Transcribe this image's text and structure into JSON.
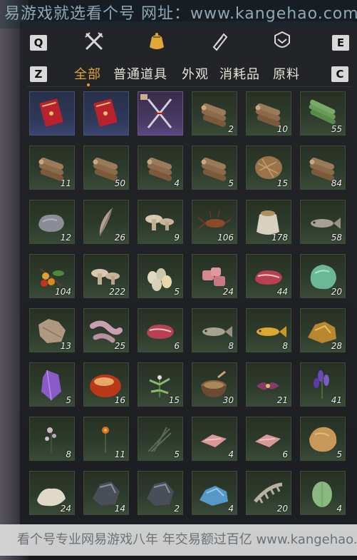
{
  "banner": {
    "text": "易游戏就选看个号   网址：www.kangehao.com"
  },
  "tabs": {
    "left_key": "Q",
    "right_key": "E",
    "icons": [
      "crossed-swords-icon",
      "pouch-icon",
      "scroll-icon",
      "shield-badge-icon"
    ],
    "active_icon": "pouch-icon"
  },
  "categories": {
    "left_key": "Z",
    "right_key": "C",
    "items": [
      "全部",
      "普通道具",
      "外观",
      "消耗品",
      "原料"
    ],
    "active": "全部"
  },
  "inventory": {
    "rows": [
      [
        {
          "icon": "red-envelope-icon",
          "qty": "",
          "rarity": "blue"
        },
        {
          "icon": "red-envelope-icon",
          "qty": "",
          "rarity": "blue"
        },
        {
          "icon": "crossed-blades-icon",
          "qty": "",
          "rarity": "purple"
        },
        {
          "icon": "wood-logs-icon",
          "qty": "2",
          "rarity": "green"
        },
        {
          "icon": "wood-logs-icon",
          "qty": "10",
          "rarity": "green"
        },
        {
          "icon": "bamboo-logs-icon",
          "qty": "55",
          "rarity": "green"
        }
      ],
      [
        {
          "icon": "wood-logs-icon",
          "qty": "11",
          "rarity": "green"
        },
        {
          "icon": "wood-logs-icon",
          "qty": "50",
          "rarity": "green"
        },
        {
          "icon": "wood-logs-icon",
          "qty": "4",
          "rarity": "green"
        },
        {
          "icon": "wood-logs-icon",
          "qty": "5",
          "rarity": "green"
        },
        {
          "icon": "fiber-bundle-icon",
          "qty": "15",
          "rarity": "green"
        },
        {
          "icon": "wood-logs-icon",
          "qty": "84",
          "rarity": "green"
        }
      ],
      [
        {
          "icon": "stone-icon",
          "qty": "12",
          "rarity": "green"
        },
        {
          "icon": "feather-icon",
          "qty": "26",
          "rarity": "green"
        },
        {
          "icon": "mushrooms-icon",
          "qty": "9",
          "rarity": "green"
        },
        {
          "icon": "crayfish-icon",
          "qty": "106",
          "rarity": "green"
        },
        {
          "icon": "grain-sack-icon",
          "qty": "178",
          "rarity": "green"
        },
        {
          "icon": "fish-icon",
          "qty": "58",
          "rarity": "green"
        }
      ],
      [
        {
          "icon": "fruit-branch-icon",
          "qty": "104",
          "rarity": "green"
        },
        {
          "icon": "mushrooms-icon",
          "qty": "222",
          "rarity": "green"
        },
        {
          "icon": "eggs-icon",
          "qty": "5",
          "rarity": "green"
        },
        {
          "icon": "meat-chunks-icon",
          "qty": "24",
          "rarity": "green"
        },
        {
          "icon": "steak-icon",
          "qty": "44",
          "rarity": "green"
        },
        {
          "icon": "jade-stone-icon",
          "qty": "20",
          "rarity": "green"
        }
      ],
      [
        {
          "icon": "hide-icon",
          "qty": "13",
          "rarity": "green"
        },
        {
          "icon": "offal-icon",
          "qty": "25",
          "rarity": "green"
        },
        {
          "icon": "steak-icon",
          "qty": "6",
          "rarity": "green"
        },
        {
          "icon": "fish-icon",
          "qty": "8",
          "rarity": "green"
        },
        {
          "icon": "golden-fish-icon",
          "qty": "8",
          "rarity": "green"
        },
        {
          "icon": "gold-ore-icon",
          "qty": "28",
          "rarity": "green"
        }
      ],
      [
        {
          "icon": "purple-crystal-icon",
          "qty": "5",
          "rarity": "green"
        },
        {
          "icon": "amber-stone-icon",
          "qty": "16",
          "rarity": "green"
        },
        {
          "icon": "herb-icon",
          "qty": "15",
          "rarity": "green"
        },
        {
          "icon": "mortar-bowl-icon",
          "qty": "30",
          "rarity": "green"
        },
        {
          "icon": "purple-flower-icon",
          "qty": "21",
          "rarity": "green"
        },
        {
          "icon": "lavender-icon",
          "qty": "41",
          "rarity": "green"
        }
      ],
      [
        {
          "icon": "small-flower-icon",
          "qty": "8",
          "rarity": "green"
        },
        {
          "icon": "orange-flower-icon",
          "qty": "11",
          "rarity": "green"
        },
        {
          "icon": "grass-bundle-icon",
          "qty": "5",
          "rarity": "green"
        },
        {
          "icon": "meat-slices-icon",
          "qty": "4",
          "rarity": "green"
        },
        {
          "icon": "meat-slices-icon",
          "qty": "6",
          "rarity": "green"
        },
        {
          "icon": "fur-pelt-icon",
          "qty": "5",
          "rarity": "green"
        }
      ],
      [
        {
          "icon": "white-coral-icon",
          "qty": "24",
          "rarity": "green"
        },
        {
          "icon": "dark-ore-icon",
          "qty": "14",
          "rarity": "green"
        },
        {
          "icon": "dark-ore-icon",
          "qty": "2",
          "rarity": "green"
        },
        {
          "icon": "blue-ore-icon",
          "qty": "4",
          "rarity": "green"
        },
        {
          "icon": "bone-spine-icon",
          "qty": "20",
          "rarity": "green"
        },
        {
          "icon": "melon-icon",
          "qty": "4",
          "rarity": "green"
        }
      ]
    ]
  },
  "footer": {
    "text": "看个号专业网易游戏八年  年交易额过百亿  www.kangehao.com"
  },
  "colors": {
    "accent": "#e0a63a",
    "text": "#e8e2d6",
    "slot_green": "#2d3b2c"
  }
}
